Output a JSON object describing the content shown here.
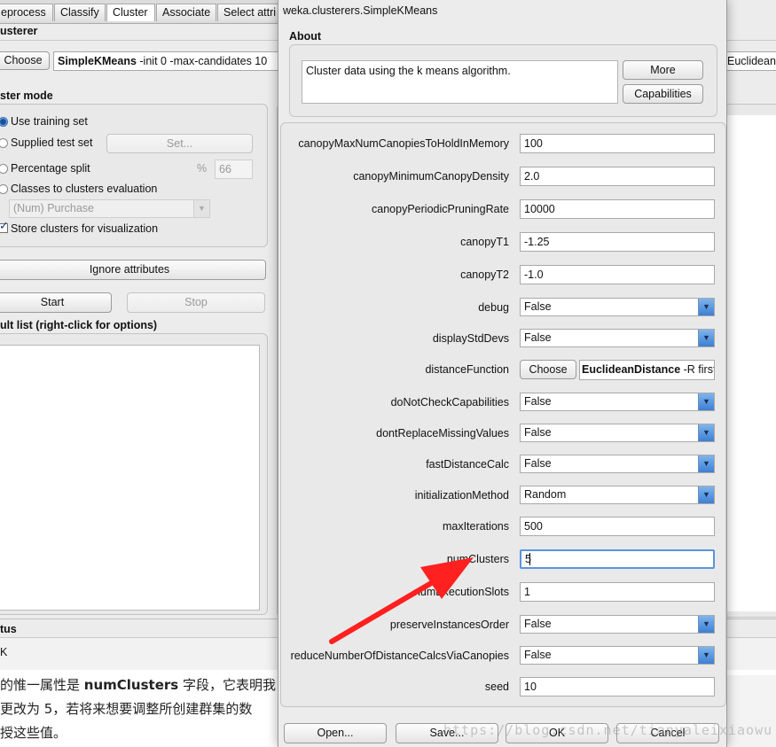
{
  "bg": {
    "tabs": [
      "eprocess",
      "Classify",
      "Cluster",
      "Associate",
      "Select attri"
    ],
    "clusterer_header": "usterer",
    "choose_label": "Choose",
    "clusterer_name": "SimpleKMeans",
    "clusterer_args": " -init 0 -max-candidates 10",
    "clusterer_right_text": "Euclidean",
    "mode_header": "ster mode",
    "use_training": "Use training set",
    "supplied_test": "Supplied test set",
    "set_label": "Set...",
    "percentage_split": "Percentage split",
    "percent_symbol": "%",
    "percent_value": "66",
    "classes_to_clusters": "Classes to clusters evaluation",
    "class_attr": "(Num) Purchase",
    "store_clusters": "Store clusters for visualization",
    "ignore_attributes": "Ignore attributes",
    "start": "Start",
    "stop": "Stop",
    "result_list": "ult list (right-click for options)",
    "status_header": "tus",
    "status_value": "K"
  },
  "article": {
    "line1_a": "的惟一属性是 ",
    "line1_b": "numClusters",
    "line1_c": " 字段，它表明我",
    "line2": "更改为 5，若将来想要调整所创建群集的数",
    "line3": "授这些值。",
    "watermark": "https://blog.csdn.net/tianyaleixiaowu"
  },
  "dialog": {
    "title": "weka.clusterers.SimpleKMeans",
    "about_header": "About",
    "about_text": "Cluster data using the k means algorithm.",
    "more": "More",
    "capabilities": "Capabilities",
    "properties": [
      {
        "name": "canopyMaxNumCanopiesToHoldInMemory",
        "type": "text",
        "value": "100"
      },
      {
        "name": "canopyMinimumCanopyDensity",
        "type": "text",
        "value": "2.0"
      },
      {
        "name": "canopyPeriodicPruningRate",
        "type": "text",
        "value": "10000"
      },
      {
        "name": "canopyT1",
        "type": "text",
        "value": "-1.25"
      },
      {
        "name": "canopyT2",
        "type": "text",
        "value": "-1.0"
      },
      {
        "name": "debug",
        "type": "select",
        "value": "False"
      },
      {
        "name": "displayStdDevs",
        "type": "select",
        "value": "False"
      },
      {
        "name": "distanceFunction",
        "type": "object",
        "choose": "Choose",
        "value_name": "EuclideanDistance",
        "value_args": " -R first-last"
      },
      {
        "name": "doNotCheckCapabilities",
        "type": "select",
        "value": "False"
      },
      {
        "name": "dontReplaceMissingValues",
        "type": "select",
        "value": "False"
      },
      {
        "name": "fastDistanceCalc",
        "type": "select",
        "value": "False"
      },
      {
        "name": "initializationMethod",
        "type": "select",
        "value": "Random"
      },
      {
        "name": "maxIterations",
        "type": "text",
        "value": "500"
      },
      {
        "name": "numClusters",
        "type": "text",
        "value": "5",
        "focused": true
      },
      {
        "name": "numExecutionSlots",
        "type": "text",
        "value": "1"
      },
      {
        "name": "preserveInstancesOrder",
        "type": "select",
        "value": "False"
      },
      {
        "name": "reduceNumberOfDistanceCalcsViaCanopies",
        "type": "select",
        "value": "False"
      },
      {
        "name": "seed",
        "type": "text",
        "value": "10"
      }
    ],
    "open": "Open...",
    "save": "Save...",
    "ok": "OK",
    "cancel": "Cancel"
  },
  "colors": {
    "arrow": "#ff2020",
    "focus_ring": "#5a95dd",
    "select_button": "#3d7fd3"
  }
}
